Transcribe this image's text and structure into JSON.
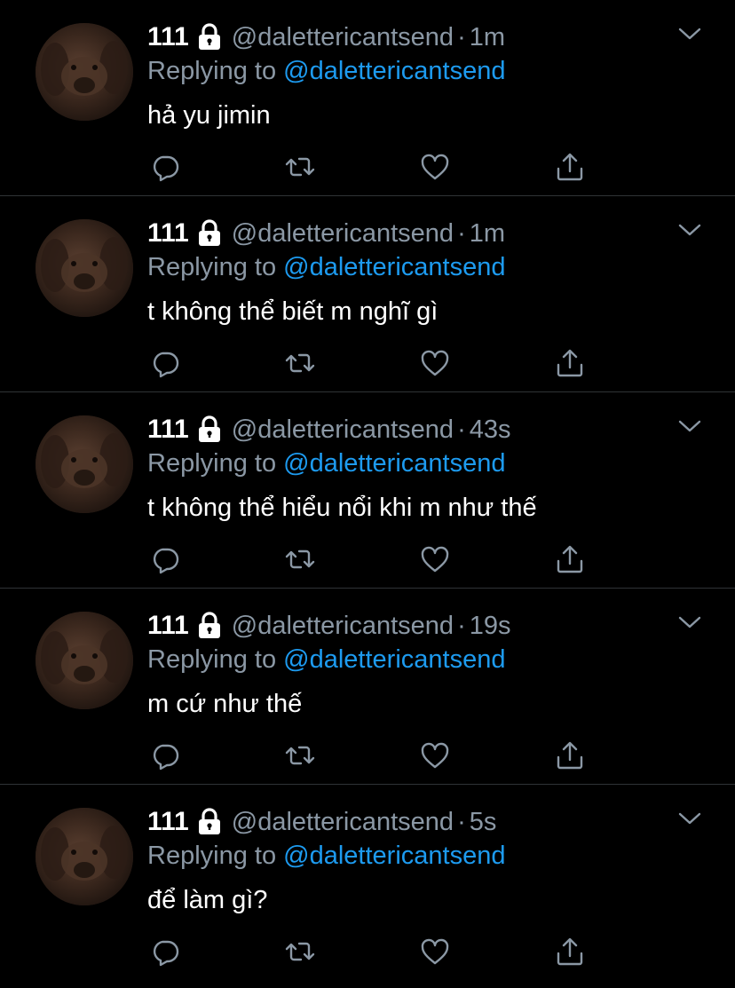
{
  "colors": {
    "background": "#000000",
    "text": "#ffffff",
    "muted": "#8b98a5",
    "link": "#1d9bf0",
    "divider": "#2f3336"
  },
  "icons": {
    "lock": "lock-icon",
    "more": "chevron-down-icon",
    "reply": "reply-icon",
    "retweet": "retweet-icon",
    "like": "heart-icon",
    "share": "share-icon"
  },
  "tweets": [
    {
      "name": "111",
      "handle": "@dalettericantsend",
      "separator": "·",
      "time": "1m",
      "reply_prefix": "Replying to",
      "reply_target": "@dalettericantsend",
      "text": "hả yu jimin"
    },
    {
      "name": "111",
      "handle": "@dalettericantsend",
      "separator": "·",
      "time": "1m",
      "reply_prefix": "Replying to",
      "reply_target": "@dalettericantsend",
      "text": "t không thể biết m nghĩ gì"
    },
    {
      "name": "111",
      "handle": "@dalettericantsend",
      "separator": "·",
      "time": "43s",
      "reply_prefix": "Replying to",
      "reply_target": "@dalettericantsend",
      "text": "t không thể hiểu nổi khi m như thế"
    },
    {
      "name": "111",
      "handle": "@dalettericantsend",
      "separator": "·",
      "time": "19s",
      "reply_prefix": "Replying to",
      "reply_target": "@dalettericantsend",
      "text": "m cứ như thế"
    },
    {
      "name": "111",
      "handle": "@dalettericantsend",
      "separator": "·",
      "time": "5s",
      "reply_prefix": "Replying to",
      "reply_target": "@dalettericantsend",
      "text": "để làm gì?"
    }
  ]
}
